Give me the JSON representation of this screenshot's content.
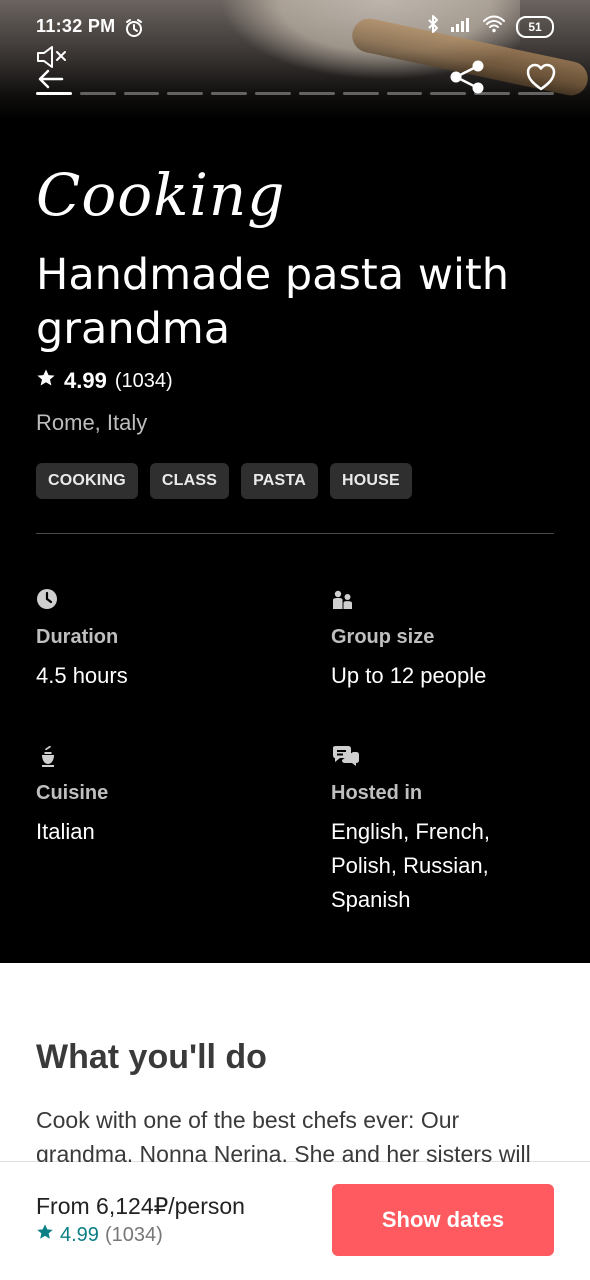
{
  "status_bar": {
    "time": "11:32 PM",
    "battery": "51"
  },
  "header": {
    "progress_segments": 12,
    "active_segment": 1
  },
  "experience": {
    "category": "Cooking",
    "title": "Handmade pasta with grandma",
    "rating": "4.99",
    "reviews": "(1034)",
    "location": "Rome, Italy",
    "tags": [
      "COOKING",
      "CLASS",
      "PASTA",
      "HOUSE"
    ]
  },
  "details": {
    "duration": {
      "label": "Duration",
      "value": "4.5 hours"
    },
    "group_size": {
      "label": "Group size",
      "value": "Up to 12 people"
    },
    "cuisine": {
      "label": "Cuisine",
      "value": "Italian"
    },
    "hosted_in": {
      "label": "Hosted in",
      "value_lines": [
        "English, French,",
        "Polish, Russian,",
        "Spanish"
      ]
    }
  },
  "about": {
    "title": "What you'll do",
    "body_lines": [
      "Cook with one of the best chefs ever: Our",
      "grandma, Nonna Nerina. She and her sisters will"
    ]
  },
  "booking": {
    "price": "From 6,124₽/person",
    "rating": "4.99",
    "reviews": "(1034)",
    "cta": "Show dates"
  },
  "colors": {
    "accent": "#ff5a5f",
    "rating_teal": "#0a7f85"
  }
}
